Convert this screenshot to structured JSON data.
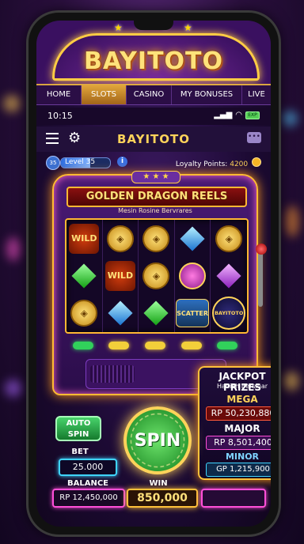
{
  "brand": {
    "logo": "BAYITOTO"
  },
  "topnav": {
    "items": [
      "HOME",
      "SLOTS",
      "CASINO",
      "MY BONUSES",
      "LIVE"
    ],
    "active": "SLOTS"
  },
  "status": {
    "time": "10:15",
    "battery_label": "EXP"
  },
  "app": {
    "title": "BAYITOTO"
  },
  "level": {
    "number": "35",
    "label": "Level 35",
    "progress": 0.6
  },
  "loyalty": {
    "label": "Loyalty Points:",
    "value": "4200"
  },
  "game": {
    "title": "GOLDEN DRAGON REELS",
    "subtitle": "Mesin Rosine Bervrares"
  },
  "reels": [
    [
      "WILD",
      "coin",
      "coin",
      "blue-gem",
      "coin"
    ],
    [
      "green-gem",
      "WILD",
      "coin",
      "jade-coin",
      "purple-gem"
    ],
    [
      "coin",
      "blue-gem",
      "green-gem",
      "SCATTER",
      "BAYITOTO"
    ]
  ],
  "jackpot": {
    "title": "JACKPOT PRIZES",
    "subtitle": "Hadiah Bersinar",
    "mega": {
      "label": "MEGA",
      "value": "RP 50,230,880"
    },
    "major": {
      "label": "MAJOR",
      "value": "RP 8,501,400"
    },
    "minor": {
      "label": "MINOR",
      "value": "GP 1,215,900"
    }
  },
  "controls": {
    "auto_spin": "AUTO SPIN",
    "spin": "SPIN",
    "bet_label": "BET",
    "bet_value": "25.000",
    "balance_label": "BALANCE",
    "balance_value": "RP 12,450,000",
    "win_label": "WIN",
    "win_value": "850,000"
  },
  "colors": {
    "accent_gold": "#ffc13a",
    "neon_pink": "#ff4fd8",
    "neon_blue": "#3fd5ff",
    "spin_green": "#13801d"
  }
}
